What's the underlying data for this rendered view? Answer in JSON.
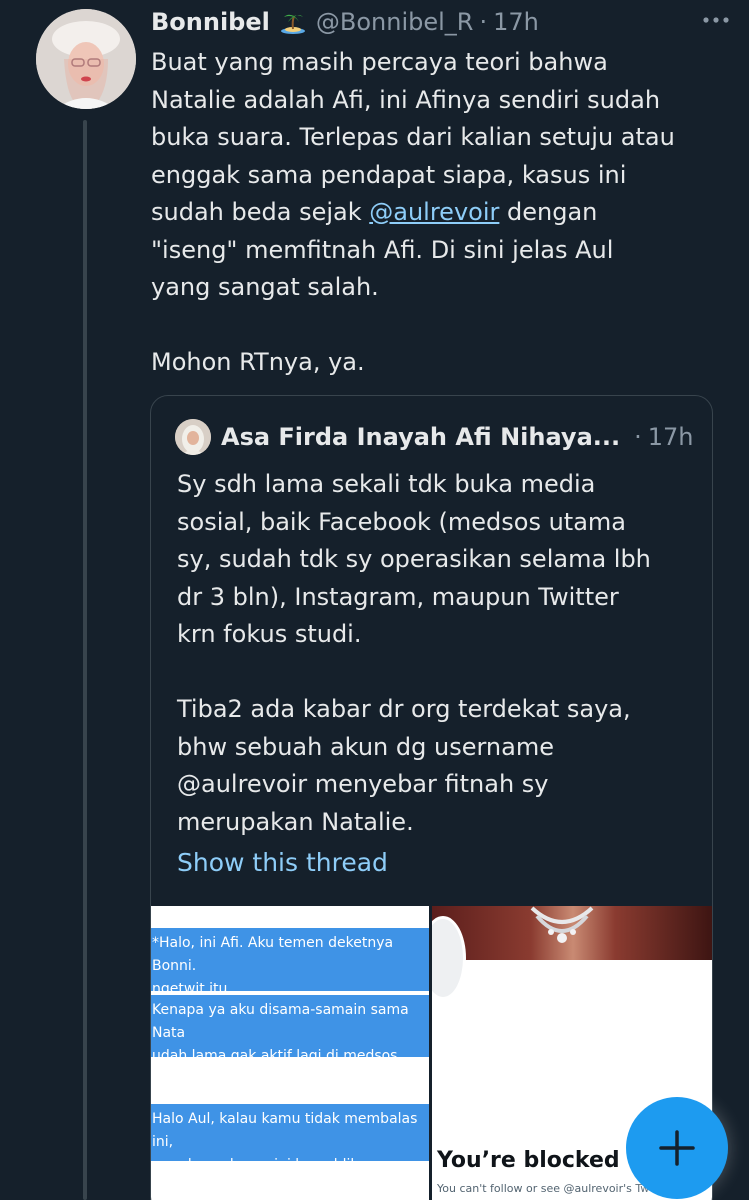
{
  "tweet": {
    "display_name": "Bonnibel",
    "name_emoji": "desert-island-emoji",
    "handle": "@Bonnibel_R",
    "separator": "·",
    "time": "17h",
    "more_menu": "more-icon",
    "text_before_mention": "Buat yang masih percaya teori bahwa\nNatalie adalah Afi, ini Afinya sendiri sudah\nbuka suara. Terlepas dari kalian setuju atau\nenggak sama pendapat siapa, kasus ini\nsudah beda sejak ",
    "mention": "@aulrevoir",
    "text_after_mention": " dengan\n\"iseng\" memfitnah Afi. Di sini jelas Aul\nyang sangat salah.\n\nMohon RTnya, ya."
  },
  "quoted_tweet": {
    "display_name": "Asa Firda Inayah Afi Nihaya...",
    "separator": "·",
    "time": "17h",
    "text": "Sy sdh lama sekali tdk buka media\nsosial, baik Facebook (medsos utama\nsy, sudah tdk sy operasikan selama lbh\ndr 3 bln), Instagram, maupun Twitter\nkrn fokus studi.\n\nTiba2 ada kabar dr org terdekat saya,\nbhw sebuah akun dg username\n@aulrevoir menyebar fitnah sy\nmerupakan Natalie.",
    "show_thread": "Show this thread",
    "media": {
      "left_messages": [
        "*Halo, ini Afi. Aku temen deketnya Bonni.\nngetwit itu.",
        "Kenapa ya aku disama-samain sama Nata\nudah lama gak aktif lagi di medsos.",
        "Halo Aul, kalau kamu tidak membalas ini,\nmembawa kasus ini ke publik."
      ],
      "right_title": "You’re blocked",
      "right_subtitle": "You can't follow or see @aulrevoir's Twee"
    }
  },
  "fab": {
    "icon": "plus-icon"
  },
  "colors": {
    "background": "#15202b",
    "link": "#8ecdf8",
    "secondary_text": "#8b98a5",
    "accent": "#1d9bf0",
    "border": "#38444d"
  }
}
